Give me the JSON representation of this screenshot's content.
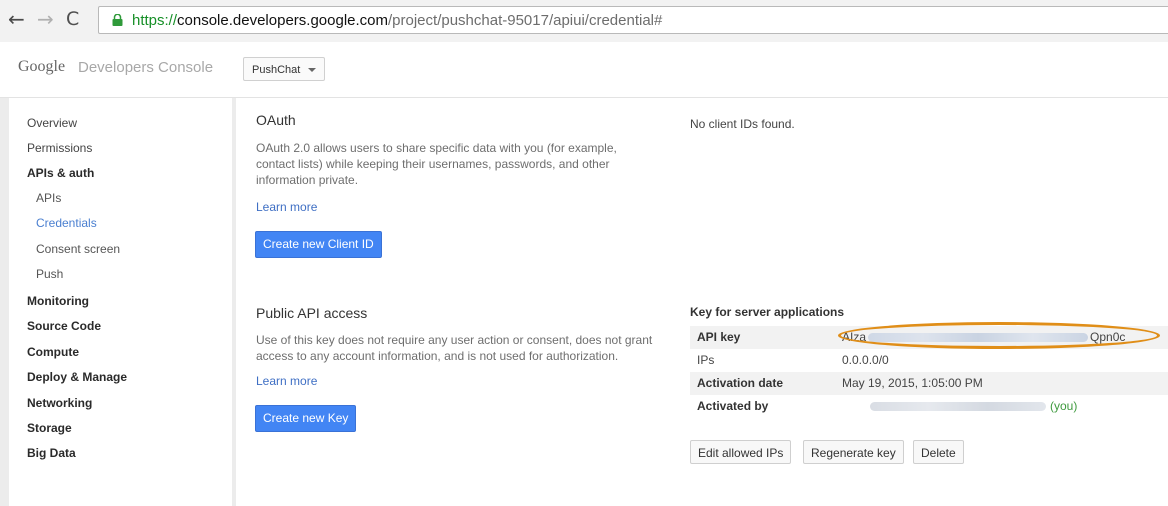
{
  "browser": {
    "back_glyph": "←",
    "forward_glyph": "→",
    "reload_glyph": "C",
    "url_scheme": "https://",
    "url_host": "console.developers.google.com",
    "url_path": "/project/pushchat-95017/apiui/credential#"
  },
  "header": {
    "brand_google": "Google",
    "brand_rest": "Developers Console",
    "project": "PushChat"
  },
  "sidebar": {
    "items": [
      {
        "label": "Overview"
      },
      {
        "label": "Permissions"
      },
      {
        "label": "APIs & auth"
      },
      {
        "label": "APIs"
      },
      {
        "label": "Credentials"
      },
      {
        "label": "Consent screen"
      },
      {
        "label": "Push"
      },
      {
        "label": "Monitoring"
      },
      {
        "label": "Source Code"
      },
      {
        "label": "Compute"
      },
      {
        "label": "Deploy & Manage"
      },
      {
        "label": "Networking"
      },
      {
        "label": "Storage"
      },
      {
        "label": "Big Data"
      }
    ],
    "active_item": "Credentials"
  },
  "oauth": {
    "title": "OAuth",
    "description_lines": [
      "OAuth 2.0 allows users to share specific data with you (for example,",
      "contact lists) while keeping their usernames, passwords, and other",
      "information private."
    ],
    "learn_more": "Learn more",
    "create_button": "Create new Client ID",
    "no_clients_text": "No client IDs found."
  },
  "public_api": {
    "title": "Public API access",
    "description_lines": [
      "Use of this key does not require any user action or consent, does not grant",
      "access to any account information, and is not used for authorization."
    ],
    "learn_more": "Learn more",
    "create_button": "Create new Key"
  },
  "server_key": {
    "title": "Key for server applications",
    "rows": {
      "api_key": {
        "label": "API key",
        "value_prefix": "AIza",
        "value_suffix": "Qpn0c"
      },
      "ips": {
        "label": "IPs",
        "value": "0.0.0.0/0"
      },
      "activation_date": {
        "label": "Activation date",
        "value": "May 19, 2015, 1:05:00 PM"
      },
      "activated_by": {
        "label": "Activated by",
        "value_suffix": "(you)"
      }
    },
    "buttons": {
      "edit_ips": "Edit allowed IPs",
      "regenerate": "Regenerate key",
      "delete": "Delete"
    }
  },
  "colors": {
    "primary_button": "#4285f4",
    "link": "#3f6fc4",
    "active_nav": "#4a7fd0",
    "highlight": "#e08e18",
    "you": "#3e9a3e",
    "secure_url": "#168f27"
  },
  "icons": [
    "arrow-left-icon",
    "arrow-right-icon",
    "reload-icon",
    "lock-icon",
    "chevron-down-icon"
  ]
}
